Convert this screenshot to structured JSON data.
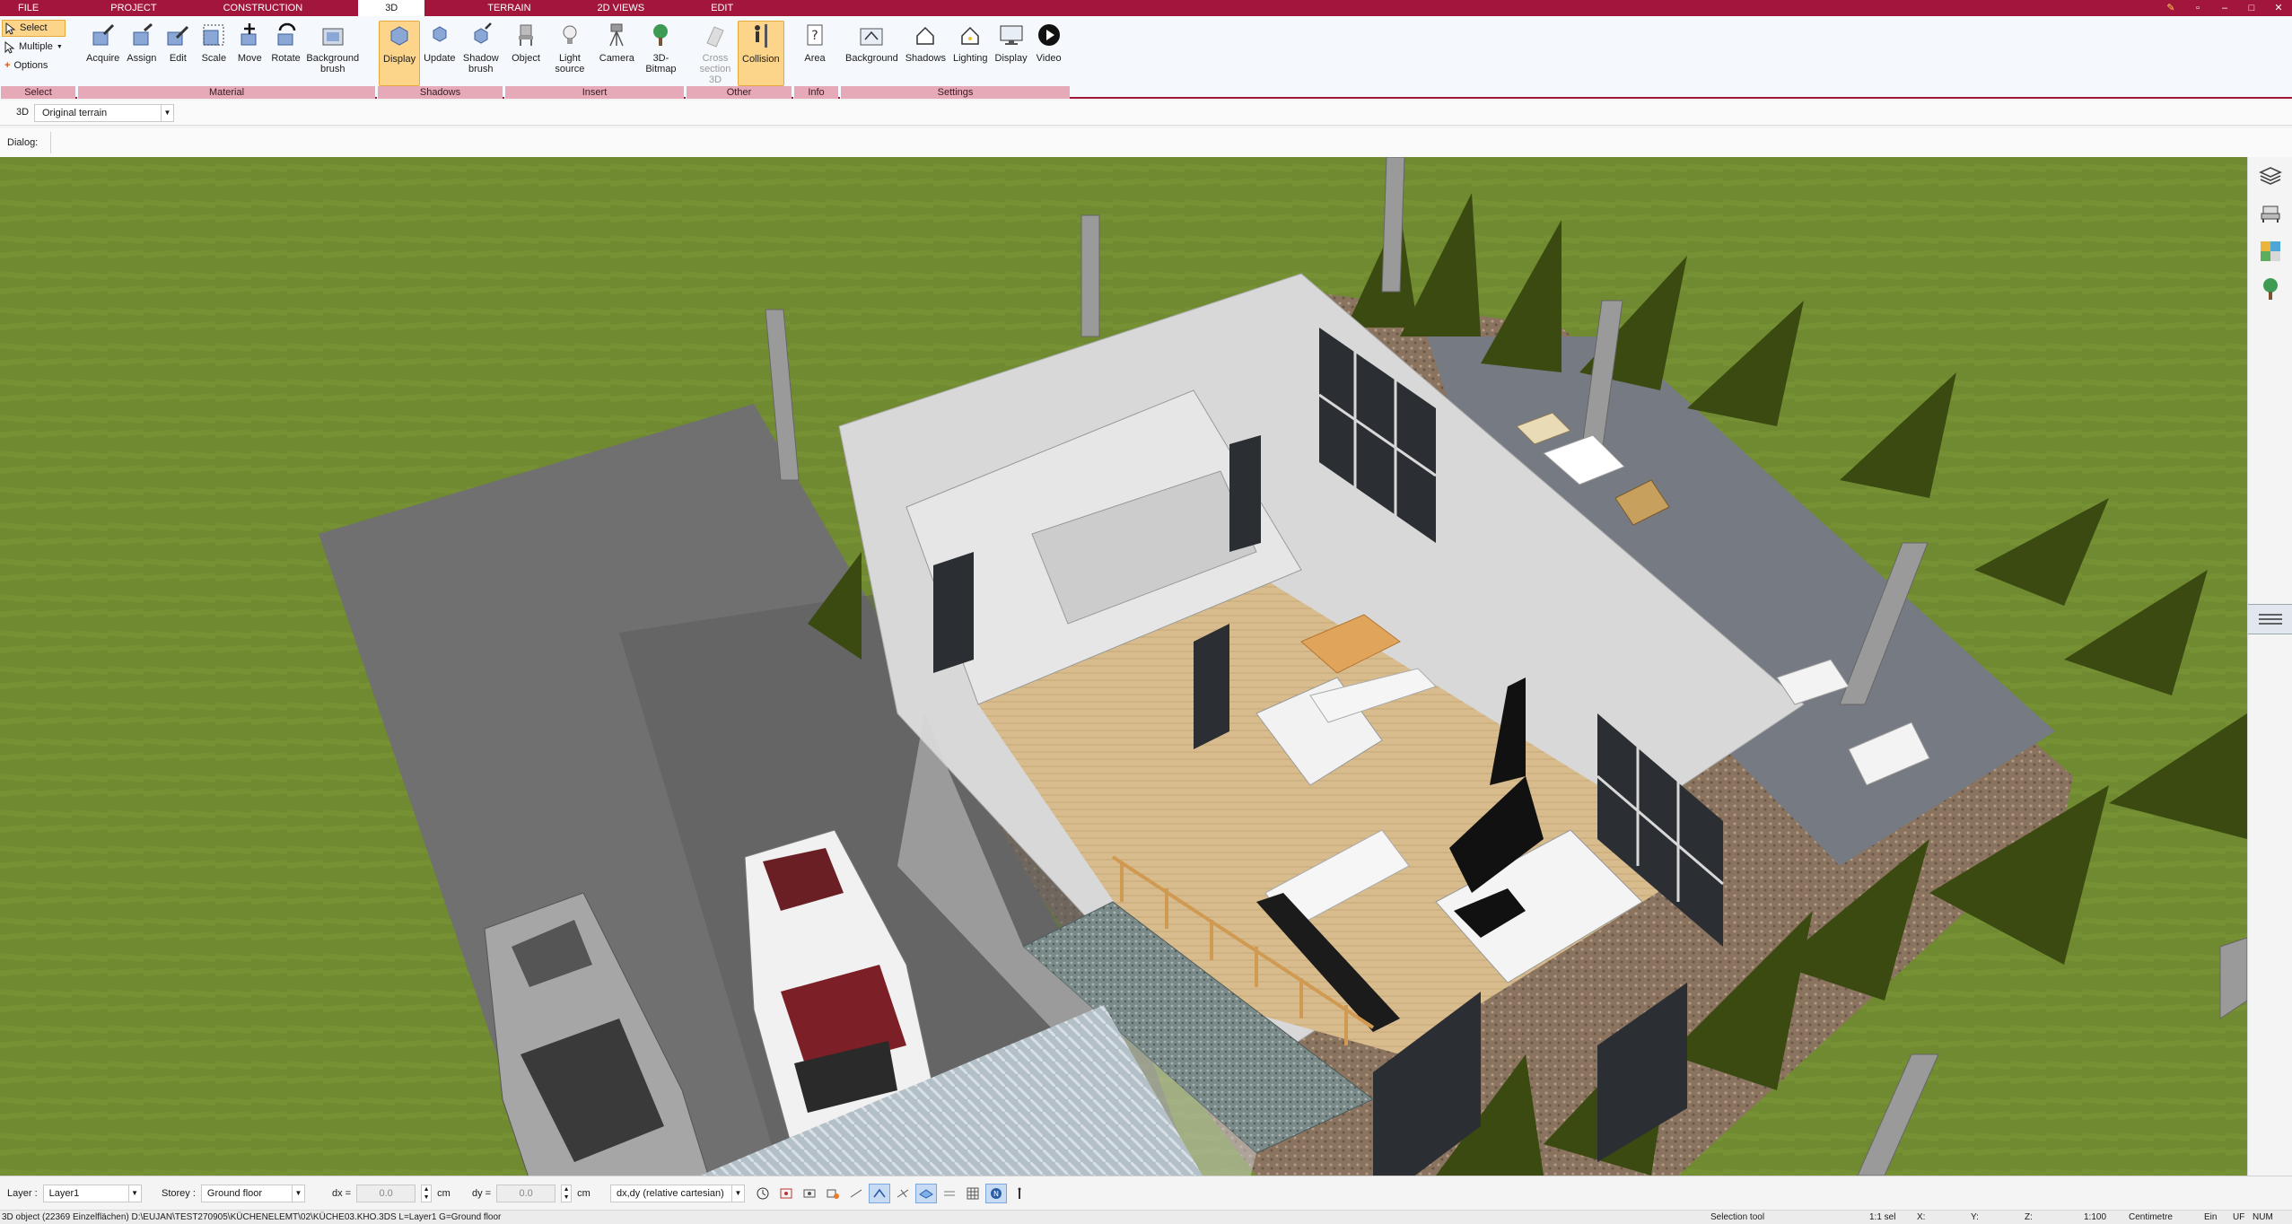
{
  "menu_tabs": [
    "FILE",
    "PROJECT",
    "CONSTRUCTION",
    "3D",
    "TERRAIN",
    "2D VIEWS",
    "EDIT"
  ],
  "active_tab": "3D",
  "select_group": {
    "label": "Select",
    "items": [
      "Select",
      "Multiple",
      "Options"
    ]
  },
  "ribbon_groups": [
    {
      "label": "Material",
      "buttons": [
        "Acquire",
        "Assign",
        "Edit",
        "Scale",
        "Move",
        "Rotate",
        "Background brush"
      ]
    },
    {
      "label": "Shadows",
      "buttons": [
        "Display",
        "Update",
        "Shadow brush"
      ]
    },
    {
      "label": "Insert",
      "buttons": [
        "Object",
        "Light source",
        "Camera",
        "3D-Bitmap"
      ]
    },
    {
      "label": "Other",
      "buttons": [
        "Cross section 3D",
        "Collision"
      ]
    },
    {
      "label": "Info",
      "buttons": [
        "Area"
      ]
    },
    {
      "label": "Settings",
      "buttons": [
        "Background",
        "Shadows",
        "Lighting",
        "Display",
        "Video"
      ]
    }
  ],
  "view_row": {
    "label": "3D",
    "terrain_select": "Original terrain"
  },
  "dialog_label": "Dialog:",
  "statusbar": {
    "layer_label": "Layer :",
    "layer_value": "Layer1",
    "storey_label": "Storey :",
    "storey_value": "Ground floor",
    "dx_label": "dx =",
    "dx_value": "0.0",
    "dx_unit": "cm",
    "dy_label": "dy =",
    "dy_value": "0.0",
    "dy_unit": "cm",
    "coord_mode": "dx,dy (relative cartesian)"
  },
  "infoline": {
    "object_info": "3D object (22369 Einzelflächen) D:\\EUJAN\\TEST270905\\KÜCHENELEMT\\02\\KÜCHE03.KHO.3DS L=Layer1 G=Ground floor",
    "tool": "Selection tool",
    "ratio": "1:1 sel",
    "x_label": "X:",
    "y_label": "Y:",
    "z_label": "Z:",
    "scale": "1:100",
    "unit": "Centimetre",
    "ein": "Ein",
    "uf": "UF",
    "num": "NUM"
  }
}
